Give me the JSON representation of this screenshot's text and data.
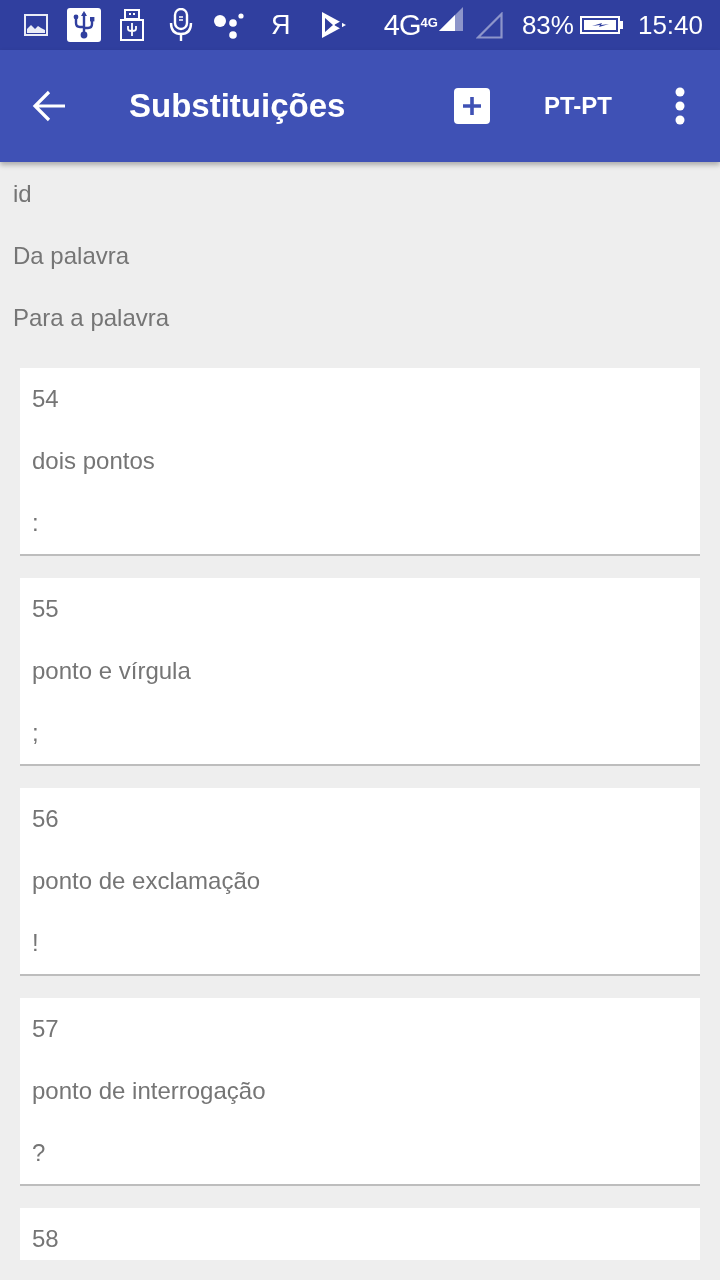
{
  "status_bar": {
    "letter_icon": "Я",
    "network": "4G",
    "network_small": "4G",
    "battery": "83%",
    "time": "15:40"
  },
  "app_bar": {
    "title": "Substituições",
    "language": "PT-PT"
  },
  "column_labels": [
    "id",
    "Da palavra",
    "Para a palavra"
  ],
  "entries": [
    {
      "id": "54",
      "from": "dois pontos",
      "to": ":"
    },
    {
      "id": "55",
      "from": "ponto e vírgula",
      "to": ";"
    },
    {
      "id": "56",
      "from": "ponto de exclamação",
      "to": "!"
    },
    {
      "id": "57",
      "from": "ponto de interrogação",
      "to": "?"
    },
    {
      "id": "58"
    }
  ]
}
